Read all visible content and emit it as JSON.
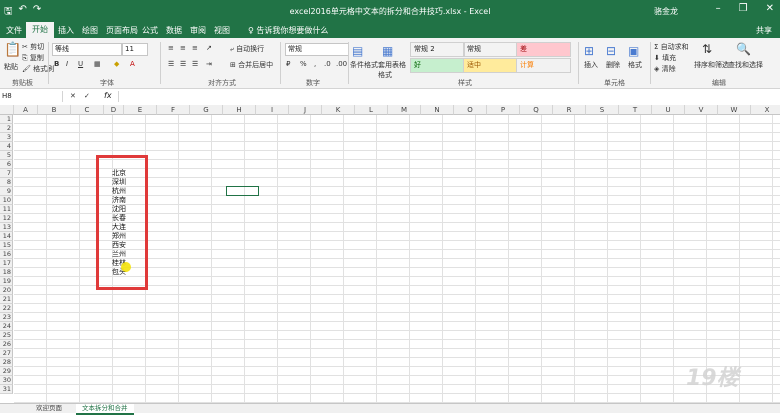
{
  "window": {
    "title": "excel2016单元格中文本的拆分和合并技巧.xlsx - Excel",
    "user": "骆金龙"
  },
  "tabs": [
    "文件",
    "开始",
    "插入",
    "绘图",
    "页面布局",
    "公式",
    "数据",
    "审阅",
    "视图"
  ],
  "active_tab": "开始",
  "tell_me": "♀ 告诉我你想要做什么",
  "share": "共享",
  "ribbon": {
    "paste": "粘贴",
    "cut": "剪切",
    "copy": "复制",
    "format_painter": "格式刷",
    "clipboard": "剪贴板",
    "font_name": "等线",
    "font_size": "11",
    "font_group": "字体",
    "wrap_text": "自动换行",
    "merge_center": "合并后居中",
    "align_group": "对齐方式",
    "number_format": "常规",
    "number_group": "数字",
    "conditional_format": "条件格式",
    "format_as_table": "套用表格格式",
    "cell_styles": "单元格样式",
    "styles_group": "样式",
    "style_items": [
      {
        "label": "常规 2",
        "bg": "#ffffff",
        "fg": "#333333"
      },
      {
        "label": "常规",
        "bg": "#ffffff",
        "fg": "#333333"
      },
      {
        "label": "差",
        "bg": "#ffc7ce",
        "fg": "#9c0006"
      },
      {
        "label": "好",
        "bg": "#c6efce",
        "fg": "#006100"
      },
      {
        "label": "适中",
        "bg": "#ffeb9c",
        "fg": "#9c5700"
      },
      {
        "label": "计算",
        "bg": "#f2f2f2",
        "fg": "#fa7d00"
      }
    ],
    "insert": "插入",
    "delete": "删除",
    "format": "格式",
    "cells_group": "单元格",
    "autosum": "自动求和",
    "fill": "填充",
    "clear": "清除",
    "sort_filter": "排序和筛选",
    "find_select": "查找和选择",
    "edit_group": "编辑"
  },
  "name_box": "H8",
  "fx": "fx",
  "columns": [
    "A",
    "B",
    "C",
    "D",
    "E",
    "F",
    "G",
    "H",
    "I",
    "J",
    "K",
    "L",
    "M",
    "N",
    "O",
    "P",
    "Q",
    "R",
    "S",
    "T",
    "U",
    "V",
    "W",
    "X"
  ],
  "rows": [
    "1",
    "2",
    "3",
    "4",
    "5",
    "6",
    "7",
    "8",
    "9",
    "10",
    "11",
    "12",
    "13",
    "14",
    "15",
    "16",
    "17",
    "18",
    "19",
    "20",
    "21",
    "22",
    "23",
    "24",
    "25",
    "26",
    "27",
    "28",
    "29",
    "30",
    "31"
  ],
  "cities": [
    "北京",
    "深圳",
    "杭州",
    "济南",
    "沈阳",
    "长春",
    "大连",
    "郑州",
    "西安",
    "兰州",
    "桂林",
    "包头"
  ],
  "sheets": [
    "欢迎页面",
    "文本拆分和合并"
  ],
  "active_sheet": "文本拆分和合并",
  "watermark": "19楼",
  "colors": {
    "accent": "#217346",
    "highlight_border": "#e03a3a"
  }
}
